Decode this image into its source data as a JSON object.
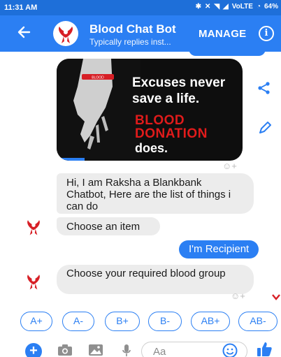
{
  "status": {
    "time": "11:31 AM",
    "network": "VoLTE",
    "battery": "64%"
  },
  "header": {
    "back_icon": "arrow-left-icon",
    "bot_name": "Blood Chat Bot",
    "subtitle": "Typically replies inst...",
    "manage_label": "MANAGE",
    "info_icon": "info-icon"
  },
  "image_card": {
    "line1": "Excuses never",
    "line2": "save a life.",
    "line3": "BLOOD",
    "line4": "DONATION",
    "line5": "does.",
    "wristband_text": "BLOOD",
    "progress_fraction": 0.15
  },
  "side_actions": [
    "share-icon",
    "edit-icon"
  ],
  "messages": {
    "intro": "Hi, I am Raksha a Blankbank Chatbot, Here are the list of things i can do",
    "choose": "Choose an item",
    "user_reply": "I'm Recipient",
    "blood_prompt": "Choose your required blood group"
  },
  "blood_groups": [
    "A+",
    "A-",
    "B+",
    "B-",
    "AB+",
    "AB-"
  ],
  "composer": {
    "placeholder": "Aa",
    "icons": [
      "plus-icon",
      "camera-icon",
      "image-icon",
      "microphone-icon",
      "emoji-icon",
      "thumbs-up-icon"
    ]
  },
  "colors": {
    "brand": "#2b7ff3",
    "status_bar": "#1e6fd9",
    "bubble_gray": "#ececec",
    "accent_red": "#e01b1b"
  }
}
